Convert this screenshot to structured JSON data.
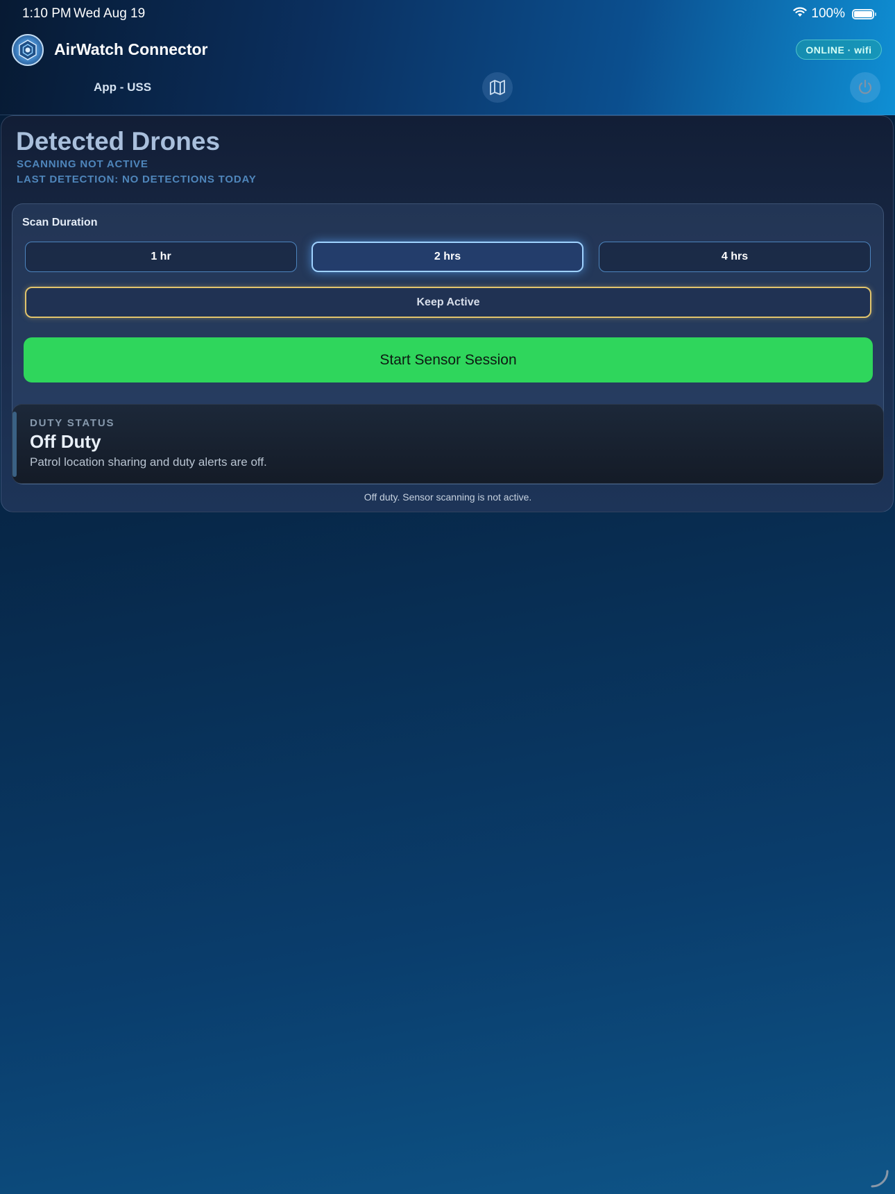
{
  "status_bar": {
    "time": "1:10 PM",
    "date": "Wed Aug 19",
    "battery": "100%"
  },
  "header": {
    "app_title": "AirWatch Connector",
    "subtitle": "App - USS",
    "connection_badge": "ONLINE · wifi",
    "icons": {
      "logo": "drone-hex-logo-icon",
      "map": "map-icon",
      "power": "power-icon"
    }
  },
  "detections": {
    "title": "Detected Drones",
    "scan_status": "SCANNING NOT ACTIVE",
    "last_detection": "LAST DETECTION: NO DETECTIONS TODAY"
  },
  "scan": {
    "label": "Scan Duration",
    "durations": [
      "1 hr",
      "2 hrs",
      "4 hrs"
    ],
    "selected_duration": "2 hrs",
    "keep_active_label": "Keep Active",
    "start_label": "Start Sensor Session"
  },
  "duty": {
    "label": "DUTY STATUS",
    "title": "Off Duty",
    "description": "Patrol location sharing and duty alerts are off."
  },
  "footer": {
    "message": "Off duty. Sensor scanning is not active."
  },
  "colors": {
    "accent_green": "#2fd65c",
    "selected_glow": "#9fd2ff",
    "keep_active_border": "#e2c46c",
    "online_badge": "#1ea0aa"
  }
}
